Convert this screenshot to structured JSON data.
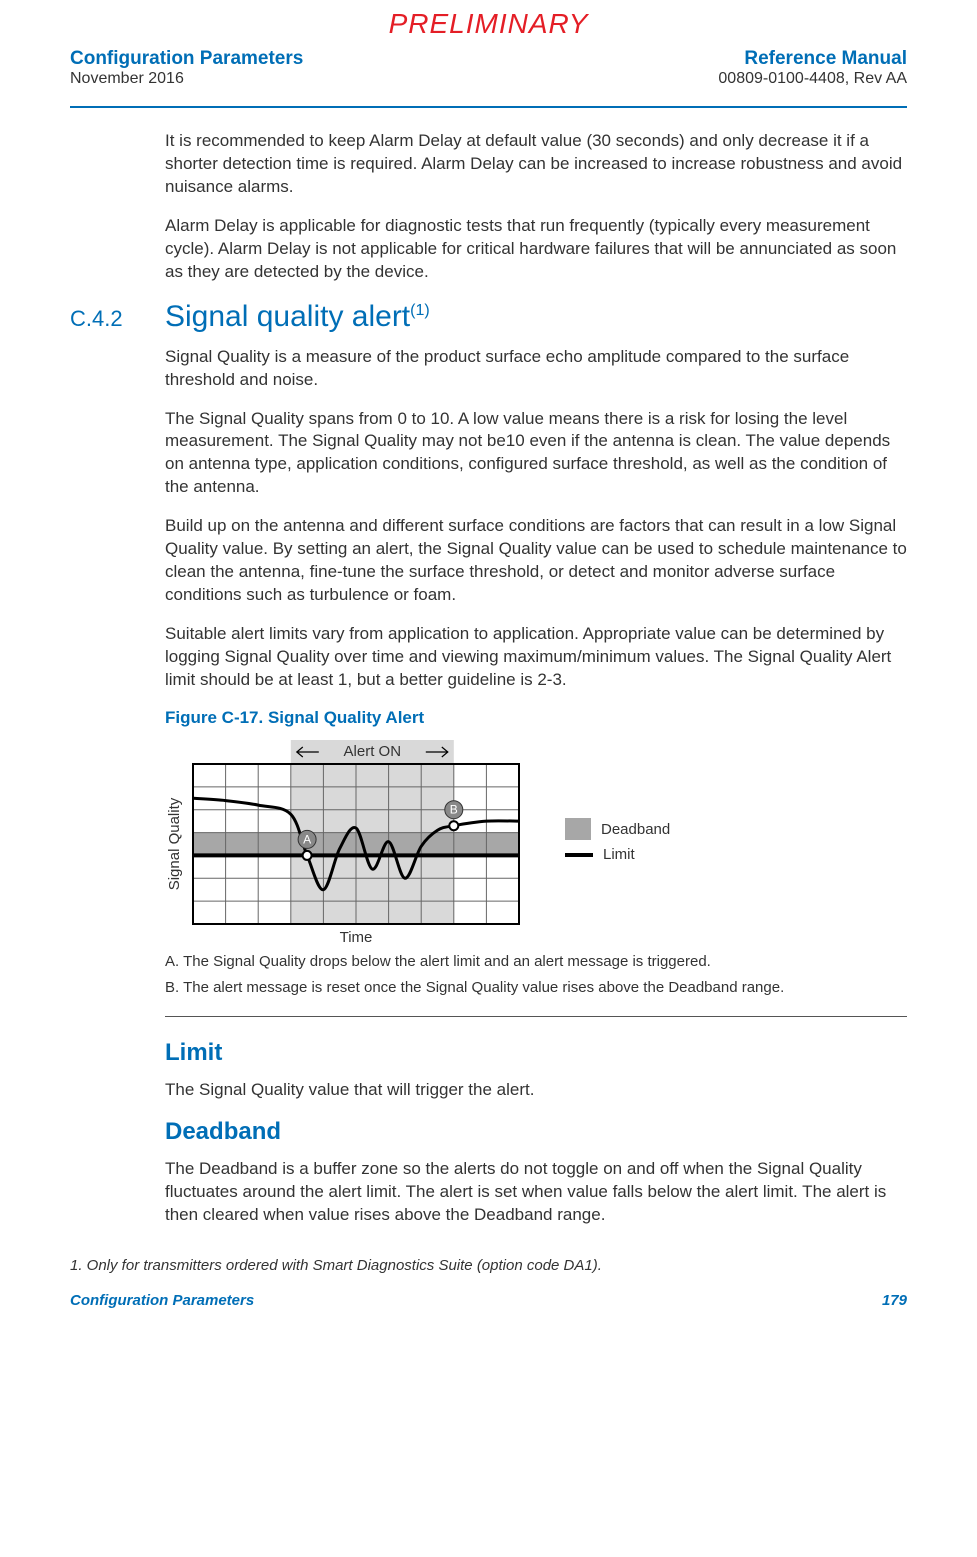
{
  "watermark": "PRELIMINARY",
  "header": {
    "left_title": "Configuration Parameters",
    "left_date": "November 2016",
    "right_title": "Reference Manual",
    "right_doc": "00809-0100-4408, Rev AA"
  },
  "intro": {
    "p1": "It is recommended to keep Alarm Delay at default value (30 seconds) and only decrease it if a shorter detection time is required. Alarm Delay can be increased to increase robustness and avoid nuisance alarms.",
    "p2": "Alarm Delay is applicable for diagnostic tests that run frequently (typically every measurement cycle). Alarm Delay is not applicable for critical hardware failures that will be annunciated as soon as they are detected by the device."
  },
  "section": {
    "number": "C.4.2",
    "title": "Signal quality alert",
    "super": "(1)"
  },
  "sq": {
    "p1": "Signal Quality is a measure of the product surface echo amplitude compared to the surface threshold and noise.",
    "p2": "The Signal Quality spans from 0 to 10. A low value means there is a risk for losing the level measurement. The Signal Quality may not be10 even if the antenna is clean. The value depends on antenna type, application conditions, configured surface threshold, as well as the condition of the antenna.",
    "p3": "Build up on the antenna and different surface conditions are factors that can result in a low Signal Quality value. By setting an alert, the Signal Quality value can be used to schedule maintenance to clean the antenna, fine-tune the surface threshold, or detect and monitor adverse surface conditions such as turbulence or foam.",
    "p4": "Suitable alert limits vary from application to application. Appropriate value can be determined by logging Signal Quality over time and viewing maximum/minimum values. The Signal Quality Alert limit should be at least 1, but a better guideline is 2-3."
  },
  "figure": {
    "title": "Figure C-17. Signal Quality Alert",
    "alert_label": "Alert ON",
    "ylabel": "Signal Quality",
    "xlabel": "Time",
    "marker_a": "A",
    "marker_b": "B",
    "legend_deadband": "Deadband",
    "legend_limit": "Limit",
    "caption_a": "A. The Signal Quality drops below the alert limit and an alert message is triggered.",
    "caption_b": "B.  The alert message is reset once the Signal Quality value rises above the Deadband range."
  },
  "limit": {
    "title": "Limit",
    "text": "The Signal Quality value that will trigger the alert."
  },
  "deadband": {
    "title": "Deadband",
    "text": "The Deadband is a buffer zone so the alerts do not toggle on and off when the Signal Quality fluctuates around the alert limit. The alert is set when value falls below the alert limit. The alert is then cleared when value rises above the Deadband range."
  },
  "footnote": "1.      Only for transmitters ordered with Smart Diagnostics Suite (option code DA1).",
  "footer": {
    "left": "Configuration Parameters",
    "right": "179"
  },
  "chart_data": {
    "type": "line",
    "title": "Signal Quality Alert",
    "xlabel": "Time",
    "ylabel": "Signal Quality",
    "ylim": [
      0,
      7
    ],
    "limit": 3,
    "deadband_top": 4,
    "alert_on_range": [
      3,
      8
    ],
    "series": [
      {
        "name": "Signal Quality",
        "x": [
          0,
          1,
          2,
          3,
          3.5,
          4,
          4.5,
          5,
          5.5,
          6,
          6.5,
          7,
          7.5,
          8,
          9,
          10
        ],
        "values": [
          5.5,
          5.4,
          5.2,
          4.8,
          3.0,
          1.5,
          3.3,
          4.2,
          2.4,
          3.6,
          2.0,
          3.4,
          4.1,
          4.3,
          4.5,
          4.5
        ]
      }
    ],
    "markers": [
      {
        "name": "A",
        "x": 3.5,
        "y": 3.0
      },
      {
        "name": "B",
        "x": 8,
        "y": 4.3
      }
    ]
  }
}
